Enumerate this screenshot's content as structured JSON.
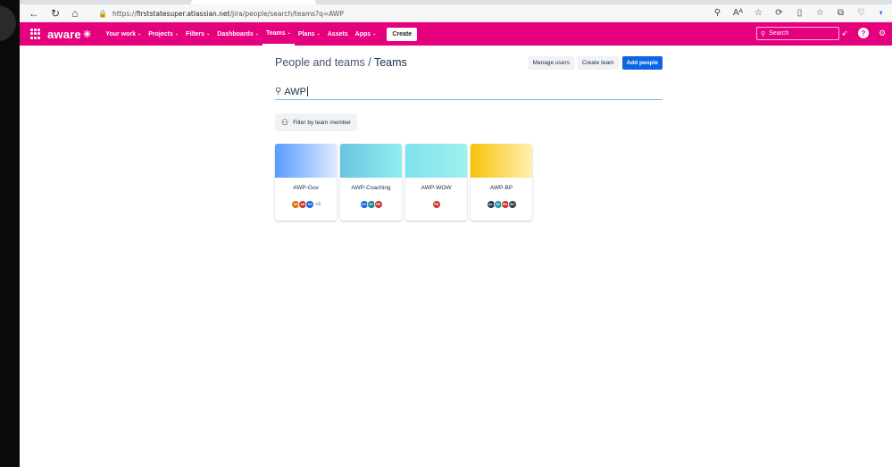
{
  "browser": {
    "url_prefix": "https://",
    "url_host": "firststatesuper.atlassian.net",
    "url_path": "/jira/people/search/teams?q=AWP"
  },
  "nav": {
    "logo": "aware",
    "menu": [
      {
        "label": "Your work",
        "chevron": true
      },
      {
        "label": "Projects",
        "chevron": true
      },
      {
        "label": "Filters",
        "chevron": true
      },
      {
        "label": "Dashboards",
        "chevron": true
      },
      {
        "label": "Teams",
        "chevron": true,
        "active": true
      },
      {
        "label": "Plans",
        "chevron": true
      },
      {
        "label": "Assets",
        "chevron": false
      },
      {
        "label": "Apps",
        "chevron": true
      }
    ],
    "create_label": "Create",
    "search_placeholder": "Search",
    "brand_color": "#e5007e"
  },
  "page": {
    "breadcrumb_parent": "People and teams",
    "separator": " / ",
    "title": "Teams",
    "manage_users": "Manage users",
    "create_team": "Create team",
    "add_people": "Add people",
    "search_value": "AWP",
    "filter_label": "Filter by team member"
  },
  "teams": [
    {
      "name": "AWP-Gov",
      "gradient": [
        "#579dff",
        "#dfe9ff"
      ],
      "avatars": [
        {
          "initials": "DD",
          "color": "#e06c00"
        },
        {
          "initials": "AK",
          "color": "#c9372c"
        },
        {
          "initials": "KS",
          "color": "#0c66e4"
        }
      ],
      "more": "+3"
    },
    {
      "name": "AWP-Coaching",
      "gradient": [
        "#6cc3e0",
        "#8ff0f2"
      ],
      "avatars": [
        {
          "initials": "KS",
          "color": "#0c66e4"
        },
        {
          "initials": "JH",
          "color": "#1d7f8c"
        },
        {
          "initials": "PB",
          "color": "#c9372c"
        }
      ],
      "more": ""
    },
    {
      "name": "AWP-WOW",
      "gradient": [
        "#7ee2f0",
        "#9ff2ec"
      ],
      "avatars": [
        {
          "initials": "PB",
          "color": "#c9372c"
        }
      ],
      "more": ""
    },
    {
      "name": "AWP-BP",
      "gradient": [
        "#f8c20a",
        "#fff0b3"
      ],
      "avatars": [
        {
          "initials": "AL",
          "color": "#1f3d5c"
        },
        {
          "initials": "JG",
          "color": "#1d9aaa"
        },
        {
          "initials": "EN",
          "color": "#c9372c"
        },
        {
          "initials": "SG",
          "color": "#2c3e50"
        }
      ],
      "more": ""
    }
  ]
}
